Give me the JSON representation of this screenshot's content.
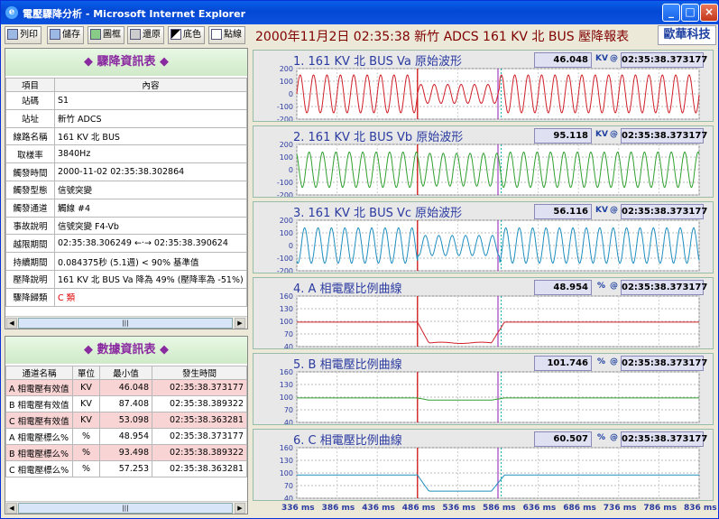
{
  "window": {
    "title": "電壓驟降分析 - Microsoft Internet Explorer"
  },
  "toolbar": {
    "print": "列印",
    "save": "儲存",
    "window": "圖框",
    "restore": "還原",
    "bgcolor": "底色",
    "points": "點線"
  },
  "report_title": "2000年11月2日 02:35:38 新竹 ADCS 161 KV 北 BUS 壓降報表",
  "brand": "歐華科技",
  "info_panel": {
    "title": "◆ 驟降資訊表 ◆",
    "col_item": "項目",
    "col_content": "內容",
    "rows": [
      {
        "k": "站碼",
        "v": "S1"
      },
      {
        "k": "站址",
        "v": "新竹 ADCS"
      },
      {
        "k": "線路名稱",
        "v": "161 KV 北 BUS"
      },
      {
        "k": "取樣率",
        "v": "3840Hz"
      },
      {
        "k": "觸發時間",
        "v": "2000-11-02 02:35:38.302864"
      },
      {
        "k": "觸發型態",
        "v": "信號突變"
      },
      {
        "k": "觸發通道",
        "v": "觸線 #4"
      },
      {
        "k": "事故說明",
        "v": "信號突變 F4-Vb"
      },
      {
        "k": "越限期間",
        "v": "02:35:38.306249 ←‧→ 02:35:38.390624"
      },
      {
        "k": "持續期間",
        "v": "0.084375秒 (5.1週) < 90% 基準值"
      },
      {
        "k": "壓降說明",
        "v": "161 KV 北 BUS Va 降為 49% (壓降率為 -51%)"
      },
      {
        "k": "驟降歸類",
        "v": "C 類"
      }
    ]
  },
  "stat_panel": {
    "title": "◆ 數據資訊表 ◆",
    "cols": [
      "通道名稱",
      "單位",
      "最小值",
      "發生時間"
    ],
    "rows": [
      {
        "name": "A 相電壓有效值",
        "unit": "KV",
        "min": "46.048",
        "time": "02:35:38.373177"
      },
      {
        "name": "B 相電壓有效值",
        "unit": "KV",
        "min": "87.408",
        "time": "02:35:38.389322"
      },
      {
        "name": "C 相電壓有效值",
        "unit": "KV",
        "min": "53.098",
        "time": "02:35:38.363281"
      },
      {
        "name": "A 相電壓標么%",
        "unit": "%",
        "min": "48.954",
        "time": "02:35:38.373177"
      },
      {
        "name": "B 相電壓標么%",
        "unit": "%",
        "min": "93.498",
        "time": "02:35:38.389322"
      },
      {
        "name": "C 相電壓標么%",
        "unit": "%",
        "min": "57.253",
        "time": "02:35:38.363281"
      }
    ]
  },
  "chart_data": [
    {
      "type": "line",
      "title": "1. 161 KV 北 BUS Va 原始波形",
      "value": "46.048",
      "unit": "KV",
      "at": "@",
      "time": "02:35:38.373177",
      "yticks": [
        "200",
        "100",
        "0",
        "-100",
        "-200"
      ],
      "ylim": [
        -200,
        200
      ],
      "color": "#d0202a",
      "kind": "wave",
      "amp_normal": 150,
      "amp_sag": 75
    },
    {
      "type": "line",
      "title": "2. 161 KV 北 BUS Vb 原始波形",
      "value": "95.118",
      "unit": "KV",
      "at": "@",
      "time": "02:35:38.373177",
      "yticks": [
        "200",
        "100",
        "0",
        "-100",
        "-200"
      ],
      "ylim": [
        -200,
        200
      ],
      "color": "#30a030",
      "kind": "wave",
      "amp_normal": 140,
      "amp_sag": 130
    },
    {
      "type": "line",
      "title": "3. 161 KV 北 BUS Vc 原始波形",
      "value": "56.116",
      "unit": "KV",
      "at": "@",
      "time": "02:35:38.373177",
      "yticks": [
        "200",
        "100",
        "0",
        "-100",
        "-200"
      ],
      "ylim": [
        -200,
        200
      ],
      "color": "#1f8fbf",
      "kind": "wave",
      "amp_normal": 140,
      "amp_sag": 80
    },
    {
      "type": "line",
      "title": "4. A 相電壓比例曲線",
      "value": "48.954",
      "unit": "%",
      "at": "@",
      "time": "02:35:38.373177",
      "yticks": [
        "160",
        "130",
        "100",
        "70",
        "40"
      ],
      "ylim": [
        40,
        160
      ],
      "color": "#d0202a",
      "kind": "rms",
      "normal": 98,
      "sag": 49
    },
    {
      "type": "line",
      "title": "5. B 相電壓比例曲線",
      "value": "101.746",
      "unit": "%",
      "at": "@",
      "time": "02:35:38.373177",
      "yticks": [
        "160",
        "130",
        "100",
        "70",
        "40"
      ],
      "ylim": [
        40,
        160
      ],
      "color": "#30a030",
      "kind": "rms",
      "normal": 98,
      "sag": 93
    },
    {
      "type": "line",
      "title": "6. C 相電壓比例曲線",
      "value": "60.507",
      "unit": "%",
      "at": "@",
      "time": "02:35:38.373177",
      "yticks": [
        "160",
        "130",
        "100",
        "70",
        "40"
      ],
      "ylim": [
        40,
        160
      ],
      "color": "#1f8fbf",
      "kind": "rms",
      "normal": 95,
      "sag": 57
    }
  ],
  "xaxis": {
    "ticks": [
      "336 ms",
      "386 ms",
      "436 ms",
      "486 ms",
      "536 ms",
      "586 ms",
      "636 ms",
      "686 ms",
      "736 ms",
      "786 ms",
      "836 ms"
    ],
    "unit": "ms",
    "markers": [
      "486 ms",
      "586 ms"
    ]
  }
}
